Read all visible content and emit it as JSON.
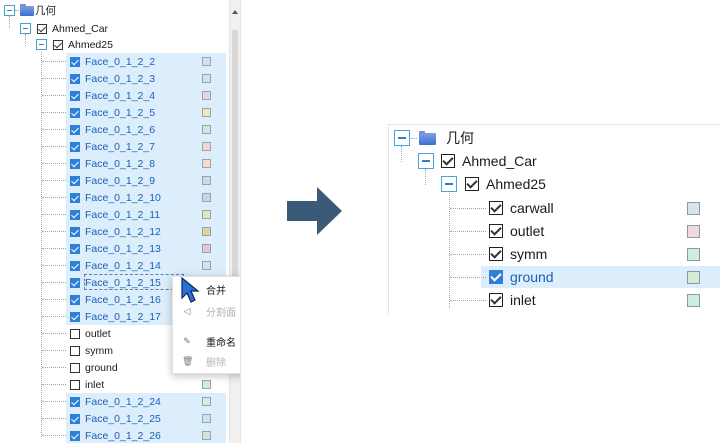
{
  "left_tree": {
    "root_label": "几何",
    "car_label": "Ahmed_Car",
    "body_label": "Ahmed25",
    "faces": [
      {
        "label": "Face_0_1_2_2",
        "color": "#cfe0ee",
        "checked": true,
        "selected": true
      },
      {
        "label": "Face_0_1_2_3",
        "color": "#cfe2ec",
        "checked": true,
        "selected": true
      },
      {
        "label": "Face_0_1_2_4",
        "color": "#e6d5ea",
        "checked": true,
        "selected": true
      },
      {
        "label": "Face_0_1_2_5",
        "color": "#efe7b8",
        "checked": true,
        "selected": true
      },
      {
        "label": "Face_0_1_2_6",
        "color": "#d1e6d7",
        "checked": true,
        "selected": true
      },
      {
        "label": "Face_0_1_2_7",
        "color": "#f0d6cf",
        "checked": true,
        "selected": true
      },
      {
        "label": "Face_0_1_2_8",
        "color": "#f3dccd",
        "checked": true,
        "selected": true
      },
      {
        "label": "Face_0_1_2_9",
        "color": "#cdd9ec",
        "checked": true,
        "selected": true
      },
      {
        "label": "Face_0_1_2_10",
        "color": "#c7d5ec",
        "checked": true,
        "selected": true
      },
      {
        "label": "Face_0_1_2_11",
        "color": "#e3e7b8",
        "checked": true,
        "selected": true
      },
      {
        "label": "Face_0_1_2_12",
        "color": "#dcd2a2",
        "checked": true,
        "selected": true
      },
      {
        "label": "Face_0_1_2_13",
        "color": "#dfc8cf",
        "checked": true,
        "selected": true
      },
      {
        "label": "Face_0_1_2_14",
        "color": "#d7e2ec",
        "checked": true,
        "selected": true
      },
      {
        "label": "Face_0_1_2_15",
        "color": "#d7e2ec",
        "checked": true,
        "selected": true
      },
      {
        "label": "Face_0_1_2_16",
        "color": "#d7e2ec",
        "checked": true,
        "selected": true
      },
      {
        "label": "Face_0_1_2_17",
        "color": "#d7e2ec",
        "checked": true,
        "selected": true
      },
      {
        "label": "outlet",
        "color": "",
        "checked": false,
        "selected": false
      },
      {
        "label": "symm",
        "color": "",
        "checked": false,
        "selected": false
      },
      {
        "label": "ground",
        "color": "",
        "checked": false,
        "selected": false
      },
      {
        "label": "inlet",
        "color": "#cfeede",
        "checked": false,
        "selected": false
      },
      {
        "label": "Face_0_1_2_24",
        "color": "#cfeede",
        "checked": true,
        "selected": true
      },
      {
        "label": "Face_0_1_2_25",
        "color": "#c8e4f0",
        "checked": true,
        "selected": true
      },
      {
        "label": "Face_0_1_2_26",
        "color": "#d2e6d8",
        "checked": true,
        "selected": true
      }
    ]
  },
  "context_menu": {
    "items": [
      {
        "label": "合并",
        "icon": "merge-icon",
        "disabled": false
      },
      {
        "label": "分割面",
        "icon": "split-icon",
        "disabled": true
      },
      {
        "label": "重命名",
        "icon": "rename-icon",
        "disabled": false
      },
      {
        "label": "删除",
        "icon": "delete-icon",
        "disabled": true
      }
    ]
  },
  "right_tree": {
    "root_label": "几何",
    "car_label": "Ahmed_Car",
    "body_label": "Ahmed25",
    "faces": [
      {
        "label": "carwall",
        "color": "#d5e6e8",
        "checked": true,
        "selected": false
      },
      {
        "label": "outlet",
        "color": "#f2d8dc",
        "checked": true,
        "selected": false
      },
      {
        "label": "symm",
        "color": "#cfeedd",
        "checked": true,
        "selected": false
      },
      {
        "label": "ground",
        "color": "#d7ead8",
        "checked": true,
        "selected": true
      },
      {
        "label": "inlet",
        "color": "#cdeedc",
        "checked": true,
        "selected": false
      }
    ]
  },
  "arrow_color": "#3a5a78",
  "selection_color": "#dceefb"
}
